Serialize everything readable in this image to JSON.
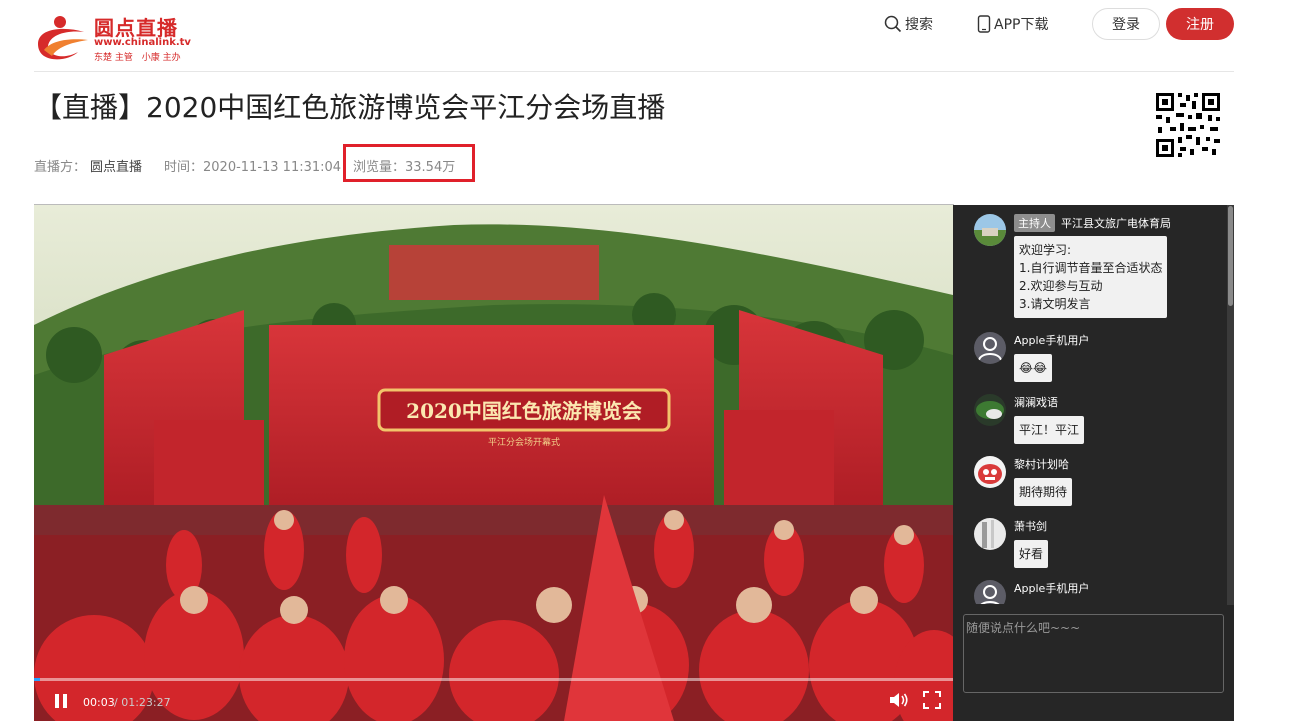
{
  "header": {
    "logo": {
      "name": "圆点直播",
      "url": "www.chinalink.tv",
      "sub_left": "东楚 主管",
      "sub_right": "小康 主办"
    },
    "nav": {
      "search": "搜索",
      "app": "APP下载"
    },
    "login": "登录",
    "register": "注册"
  },
  "page": {
    "title": "【直播】2020中国红色旅游博览会平江分会场直播",
    "host_label": "直播方：",
    "host": "圆点直播",
    "time": "时间：2020-11-13 11:31:04",
    "views": "浏览量：33.54万"
  },
  "player": {
    "stage_text": "2020中国红色旅游博览会",
    "stage_subtitle": "平江分会场开幕式",
    "time_current": "00:03",
    "time_total": "/ 01:23:27",
    "progress_fraction": 0.002
  },
  "chat": {
    "host_badge": "主持人",
    "messages": [
      {
        "user": "平江县文旅广电体育局",
        "text": "欢迎学习:\n1.自行调节音量至合适状态\n2.欢迎参与互动\n3.请文明发言"
      },
      {
        "user": "Apple手机用户",
        "text": "😂😂"
      },
      {
        "user": "澜澜戏语",
        "text": "平江！平江"
      },
      {
        "user": "黎村计划哈",
        "text": "期待期待"
      },
      {
        "user": "萧书剑",
        "text": "好看"
      },
      {
        "user": "Apple手机用户",
        "text": ""
      }
    ],
    "input_placeholder": "随便说点什么吧~~~"
  },
  "colors": {
    "brand_red": "#d12f2f",
    "highlight_box": "#e0202a",
    "chat_bg": "#262626"
  }
}
